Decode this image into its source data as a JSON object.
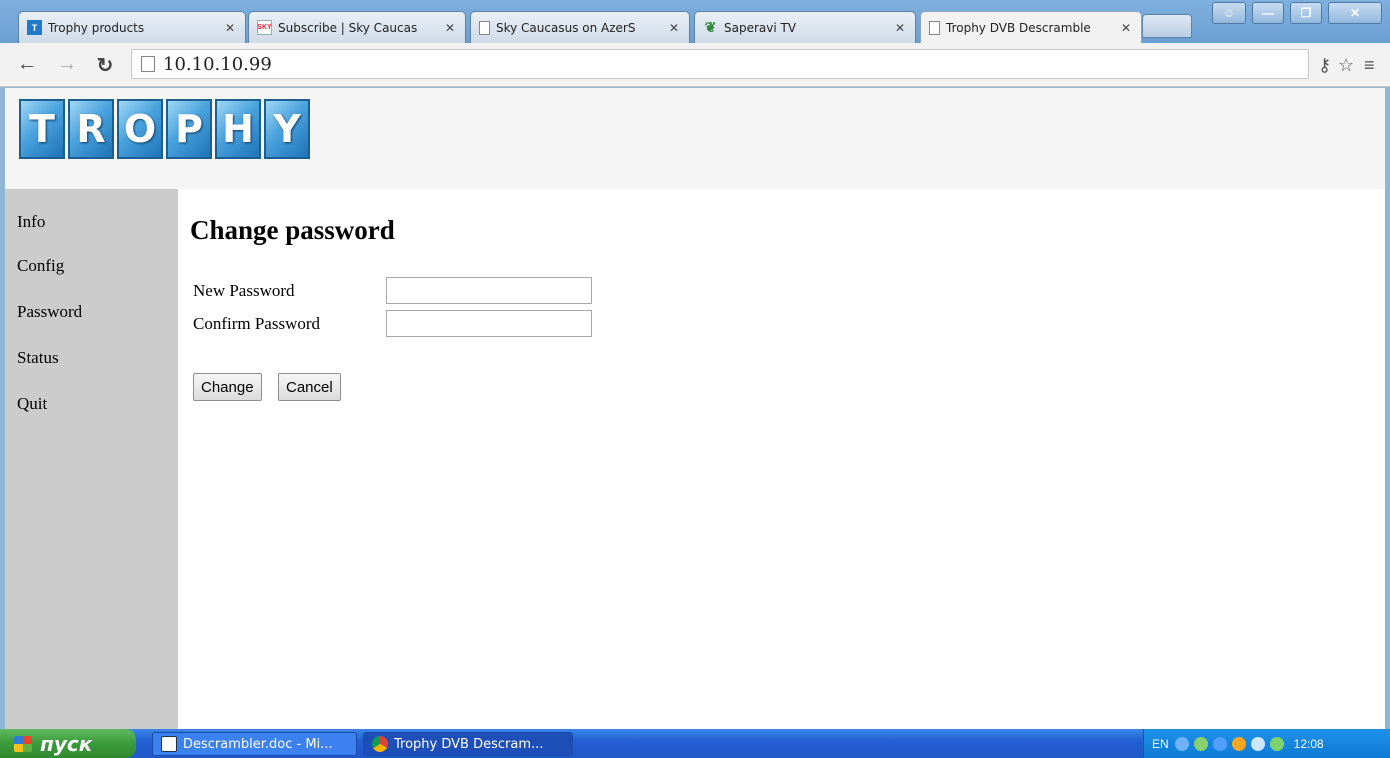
{
  "browser": {
    "tabs": [
      {
        "title": "Trophy products",
        "favicon": "T",
        "active": false
      },
      {
        "title": "Subscribe | Sky Caucas",
        "favicon": "sky",
        "active": false
      },
      {
        "title": "Sky Caucasus on AzerS",
        "favicon": "page",
        "active": false
      },
      {
        "title": "Saperavi TV",
        "favicon": "saperavi",
        "active": false
      },
      {
        "title": "Trophy DVB Descramble",
        "favicon": "page",
        "active": true
      }
    ],
    "address": "10.10.10.99",
    "colors": {
      "tabstrip": "#6a9fd2",
      "toolbar": "#f2f2f2"
    }
  },
  "header": {
    "logo_letters": [
      "T",
      "R",
      "O",
      "P",
      "H",
      "Y"
    ]
  },
  "sidebar": {
    "items": [
      {
        "label": "Info"
      },
      {
        "label": "Config"
      },
      {
        "label": "Password"
      },
      {
        "label": "Status"
      },
      {
        "label": "Quit"
      }
    ]
  },
  "main": {
    "title": "Change password",
    "fields": [
      {
        "label": "New Password",
        "value": "",
        "type": "password"
      },
      {
        "label": "Confirm Password",
        "value": "",
        "type": "password"
      }
    ],
    "buttons": {
      "change": "Change",
      "cancel": "Cancel"
    }
  },
  "taskbar": {
    "start_label": "пуск",
    "tasks": [
      {
        "label": "Descrambler.doc - Mi...",
        "icon": "word-icon"
      },
      {
        "label": "Trophy DVB Descram...",
        "icon": "chrome-icon"
      }
    ],
    "tray": {
      "lang": "EN",
      "clock": "12:08"
    }
  }
}
